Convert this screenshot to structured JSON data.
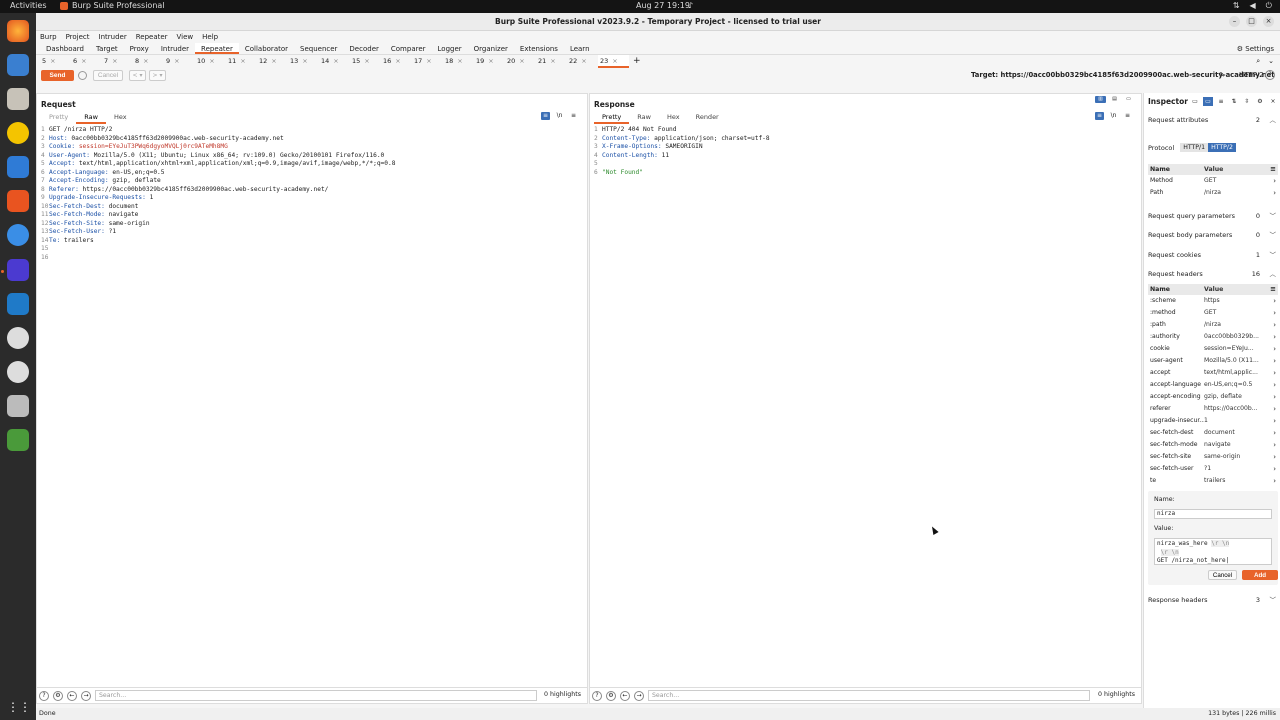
{
  "topbar": {
    "activities": "Activities",
    "app": "Burp Suite Professional",
    "clock": "Aug 27  19:19"
  },
  "window": {
    "title": "Burp Suite Professional v2023.9.2 - Temporary Project - licensed to trial user"
  },
  "menu": [
    "Burp",
    "Project",
    "Intruder",
    "Repeater",
    "View",
    "Help"
  ],
  "tools": [
    "Dashboard",
    "Target",
    "Proxy",
    "Intruder",
    "Repeater",
    "Collaborator",
    "Sequencer",
    "Decoder",
    "Comparer",
    "Logger",
    "Organizer",
    "Extensions",
    "Learn"
  ],
  "settings_label": "Settings",
  "repeater_tabs": [
    "5",
    "6",
    "7",
    "8",
    "9",
    "10",
    "11",
    "12",
    "13",
    "14",
    "15",
    "16",
    "17",
    "18",
    "19",
    "20",
    "21",
    "22",
    "23"
  ],
  "actions": {
    "send": "Send",
    "cancel": "Cancel",
    "back": "<",
    "fwd": ">"
  },
  "target": {
    "label": "Target: https://0acc00bb0329bc4185f63d2009900ac.web-security-academy.net",
    "protocol": "HTTP/2"
  },
  "request": {
    "title": "Request",
    "tabs": [
      "Pretty",
      "Raw",
      "Hex"
    ],
    "lines": [
      {
        "n": "1",
        "k": "GET /nirza HTTP/2",
        "v": ""
      },
      {
        "n": "2",
        "k": "Host: ",
        "v": "0acc00bb0329bc4185ff63d2009900ac.web-security-academy.net"
      },
      {
        "n": "3",
        "k": "Cookie: ",
        "v": "session=EYeJuT3PWq6dgyoMVQLj0rc9ATeMh8MG"
      },
      {
        "n": "4",
        "k": "User-Agent: ",
        "v": "Mozilla/5.0 (X11; Ubuntu; Linux x86_64; rv:109.0) Gecko/20100101 Firefox/116.0"
      },
      {
        "n": "5",
        "k": "Accept: ",
        "v": "text/html,application/xhtml+xml,application/xml;q=0.9,image/avif,image/webp,*/*;q=0.8"
      },
      {
        "n": "6",
        "k": "Accept-Language: ",
        "v": "en-US,en;q=0.5"
      },
      {
        "n": "7",
        "k": "Accept-Encoding: ",
        "v": "gzip, deflate"
      },
      {
        "n": "8",
        "k": "Referer: ",
        "v": "https://0acc00bb0329bc4185ff63d2009900ac.web-security-academy.net/"
      },
      {
        "n": "9",
        "k": "Upgrade-Insecure-Requests: ",
        "v": "1"
      },
      {
        "n": "10",
        "k": "Sec-Fetch-Dest: ",
        "v": "document"
      },
      {
        "n": "11",
        "k": "Sec-Fetch-Mode: ",
        "v": "navigate"
      },
      {
        "n": "12",
        "k": "Sec-Fetch-Site: ",
        "v": "same-origin"
      },
      {
        "n": "13",
        "k": "Sec-Fetch-User: ",
        "v": "?1"
      },
      {
        "n": "14",
        "k": "Te: ",
        "v": "trailers"
      },
      {
        "n": "15",
        "k": "",
        "v": ""
      },
      {
        "n": "16",
        "k": "",
        "v": ""
      }
    ]
  },
  "response": {
    "title": "Response",
    "tabs": [
      "Pretty",
      "Raw",
      "Hex",
      "Render"
    ],
    "lines": [
      {
        "n": "1",
        "k": "HTTP/2 404 Not Found",
        "v": ""
      },
      {
        "n": "2",
        "k": "Content-Type: ",
        "v": "application/json; charset=utf-8"
      },
      {
        "n": "3",
        "k": "X-Frame-Options: ",
        "v": "SAMEORIGIN"
      },
      {
        "n": "4",
        "k": "Content-Length: ",
        "v": "11"
      },
      {
        "n": "5",
        "k": "",
        "v": ""
      },
      {
        "n": "6",
        "k": "",
        "v": "\"Not Found\""
      }
    ]
  },
  "search": {
    "placeholder": "Search...",
    "highlights": "0 highlights"
  },
  "inspector": {
    "title": "Inspector",
    "req_attrs": {
      "label": "Request attributes",
      "count": "2"
    },
    "protocol_label": "Protocol",
    "protocols": [
      "HTTP/1",
      "HTTP/2"
    ],
    "col_name": "Name",
    "col_value": "Value",
    "attrs": [
      {
        "name": "Method",
        "value": "GET"
      },
      {
        "name": "Path",
        "value": "/nirza"
      }
    ],
    "query_params": {
      "label": "Request query parameters",
      "count": "0"
    },
    "body_params": {
      "label": "Request body parameters",
      "count": "0"
    },
    "cookies": {
      "label": "Request cookies",
      "count": "1"
    },
    "req_headers": {
      "label": "Request headers",
      "count": "16"
    },
    "headers": [
      {
        "name": ":scheme",
        "value": "https"
      },
      {
        "name": ":method",
        "value": "GET"
      },
      {
        "name": ":path",
        "value": "/nirza"
      },
      {
        "name": ":authority",
        "value": "0acc00bb0329b..."
      },
      {
        "name": "cookie",
        "value": "session=EYeJu..."
      },
      {
        "name": "user-agent",
        "value": "Mozilla/5.0 (X11..."
      },
      {
        "name": "accept",
        "value": "text/html,applic..."
      },
      {
        "name": "accept-language",
        "value": "en-US,en;q=0.5"
      },
      {
        "name": "accept-encoding",
        "value": "gzip, deflate"
      },
      {
        "name": "referer",
        "value": "https://0acc00b..."
      },
      {
        "name": "upgrade-insecur...",
        "value": "1"
      },
      {
        "name": "sec-fetch-dest",
        "value": "document"
      },
      {
        "name": "sec-fetch-mode",
        "value": "navigate"
      },
      {
        "name": "sec-fetch-site",
        "value": "same-origin"
      },
      {
        "name": "sec-fetch-user",
        "value": "?1"
      },
      {
        "name": "te",
        "value": "trailers"
      }
    ],
    "edit": {
      "name_label": "Name:",
      "name_value": "nirza",
      "value_label": "Value:",
      "value_line1": "nirza_was_here",
      "value_esc": "\\r \\n",
      "value_line3": "GET /nirza_not_here",
      "cancel": "Cancel",
      "add": "Add"
    },
    "resp_headers": {
      "label": "Response headers",
      "count": "3"
    }
  },
  "status": {
    "left": "Done",
    "right": "131 bytes | 226 millis"
  },
  "colors": {
    "accent": "#e8632a",
    "selected": "#3b6fb6"
  }
}
